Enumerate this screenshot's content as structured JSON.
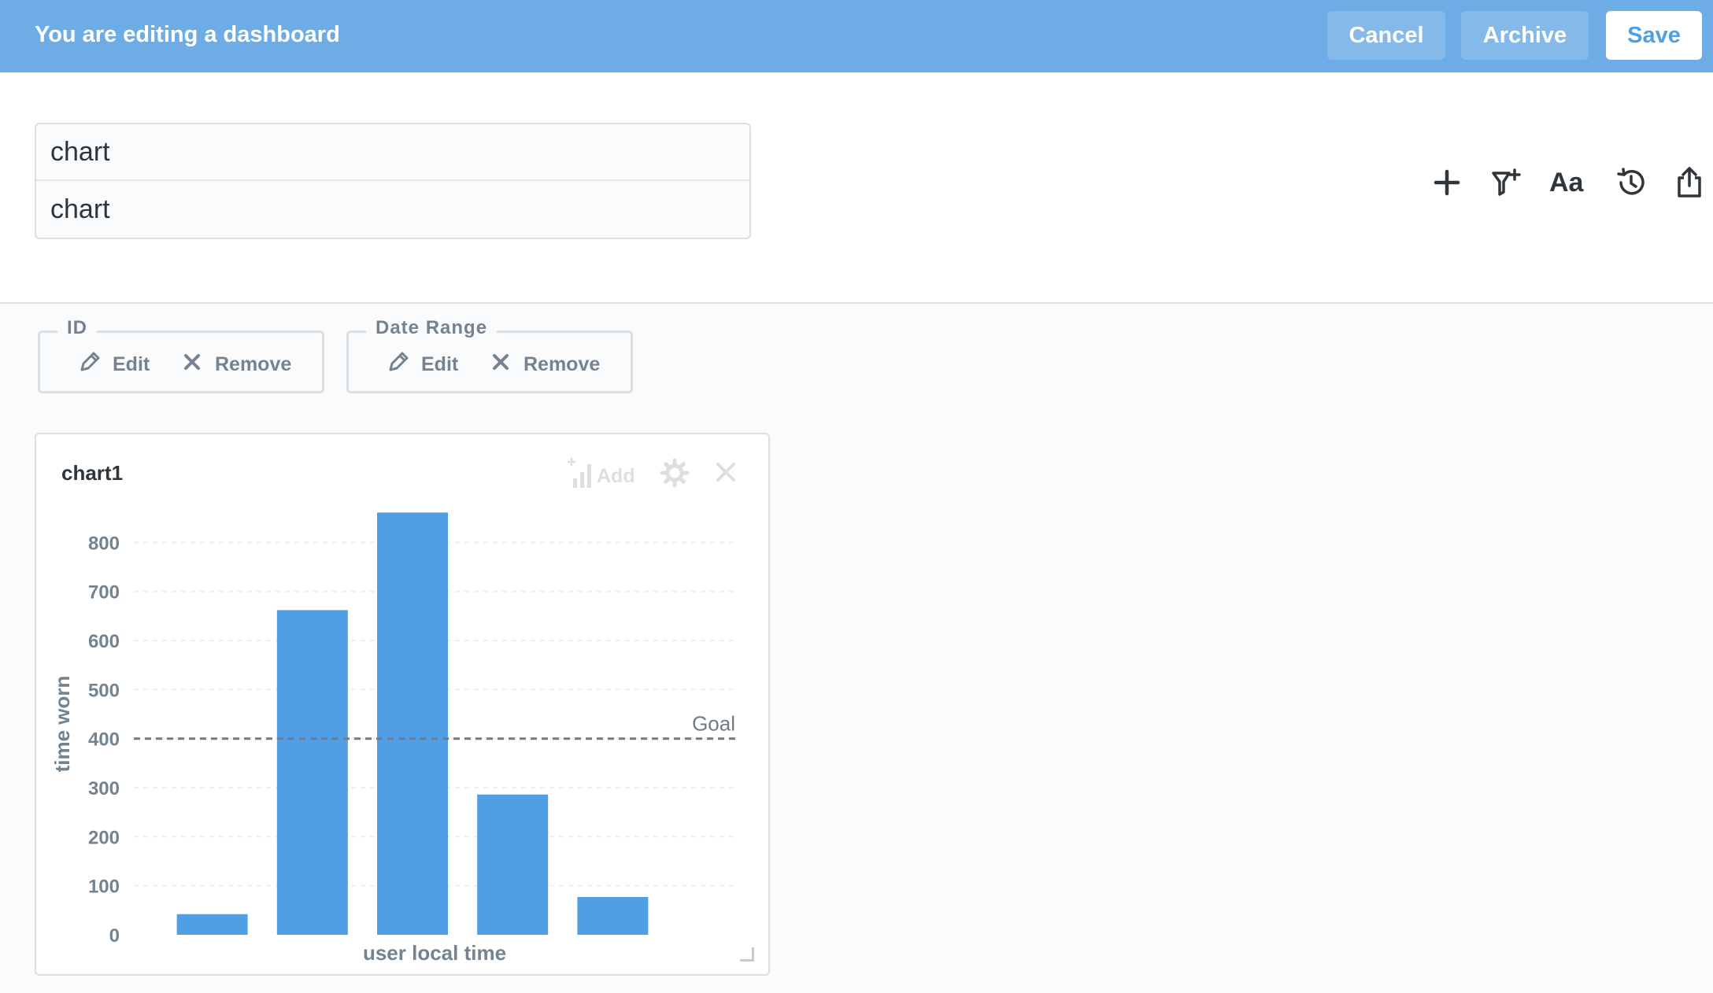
{
  "edit_bar": {
    "title": "You are editing a dashboard",
    "cancel_label": "Cancel",
    "archive_label": "Archive",
    "save_label": "Save"
  },
  "header": {
    "title_value": "chart",
    "description_value": "chart",
    "icons": [
      "add-icon",
      "filter-add-icon",
      "text-card-icon",
      "history-icon",
      "share-icon"
    ],
    "text_icon_label": "Aa"
  },
  "filters": [
    {
      "name": "ID",
      "edit_label": "Edit",
      "remove_label": "Remove"
    },
    {
      "name": "Date Range",
      "edit_label": "Edit",
      "remove_label": "Remove"
    }
  ],
  "card": {
    "title": "chart1",
    "add_label": "Add"
  },
  "colors": {
    "accent": "#509ee3",
    "edit_bar": "#6eace5",
    "bar_fill": "#509ee3",
    "goal_line": "#727b82",
    "muted_text": "#74838f"
  },
  "chart_data": {
    "type": "bar",
    "categories": [
      "",
      "",
      "",
      "",
      ""
    ],
    "values": [
      42,
      662,
      861,
      286,
      77
    ],
    "xlabel": "user local time",
    "ylabel": "time worn",
    "ylim": [
      0,
      860
    ],
    "yticks": [
      0,
      100,
      200,
      300,
      400,
      500,
      600,
      700,
      800
    ],
    "grid": true,
    "goal": {
      "value": 400,
      "label": "Goal"
    }
  }
}
